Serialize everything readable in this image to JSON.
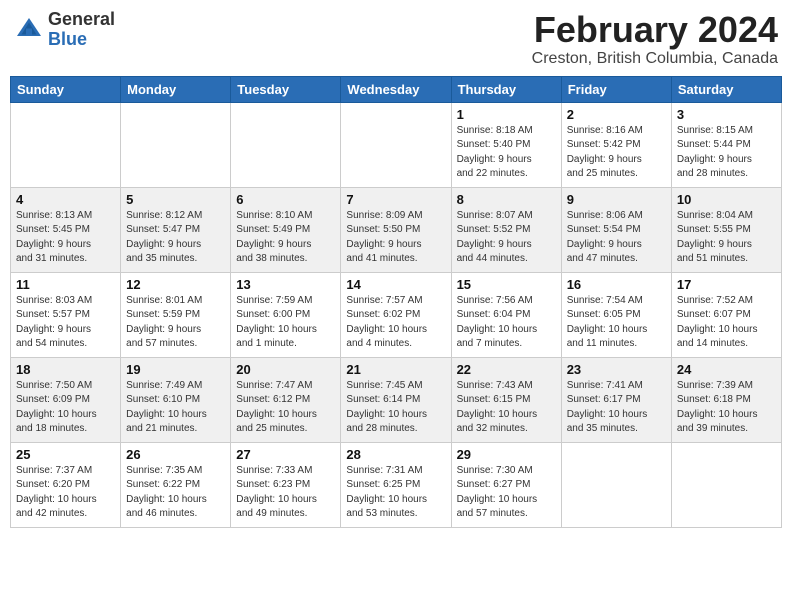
{
  "header": {
    "logo_general": "General",
    "logo_blue": "Blue",
    "month_title": "February 2024",
    "location": "Creston, British Columbia, Canada"
  },
  "days_of_week": [
    "Sunday",
    "Monday",
    "Tuesday",
    "Wednesday",
    "Thursday",
    "Friday",
    "Saturday"
  ],
  "weeks": [
    [
      {
        "day": "",
        "info": ""
      },
      {
        "day": "",
        "info": ""
      },
      {
        "day": "",
        "info": ""
      },
      {
        "day": "",
        "info": ""
      },
      {
        "day": "1",
        "info": "Sunrise: 8:18 AM\nSunset: 5:40 PM\nDaylight: 9 hours\nand 22 minutes."
      },
      {
        "day": "2",
        "info": "Sunrise: 8:16 AM\nSunset: 5:42 PM\nDaylight: 9 hours\nand 25 minutes."
      },
      {
        "day": "3",
        "info": "Sunrise: 8:15 AM\nSunset: 5:44 PM\nDaylight: 9 hours\nand 28 minutes."
      }
    ],
    [
      {
        "day": "4",
        "info": "Sunrise: 8:13 AM\nSunset: 5:45 PM\nDaylight: 9 hours\nand 31 minutes."
      },
      {
        "day": "5",
        "info": "Sunrise: 8:12 AM\nSunset: 5:47 PM\nDaylight: 9 hours\nand 35 minutes."
      },
      {
        "day": "6",
        "info": "Sunrise: 8:10 AM\nSunset: 5:49 PM\nDaylight: 9 hours\nand 38 minutes."
      },
      {
        "day": "7",
        "info": "Sunrise: 8:09 AM\nSunset: 5:50 PM\nDaylight: 9 hours\nand 41 minutes."
      },
      {
        "day": "8",
        "info": "Sunrise: 8:07 AM\nSunset: 5:52 PM\nDaylight: 9 hours\nand 44 minutes."
      },
      {
        "day": "9",
        "info": "Sunrise: 8:06 AM\nSunset: 5:54 PM\nDaylight: 9 hours\nand 47 minutes."
      },
      {
        "day": "10",
        "info": "Sunrise: 8:04 AM\nSunset: 5:55 PM\nDaylight: 9 hours\nand 51 minutes."
      }
    ],
    [
      {
        "day": "11",
        "info": "Sunrise: 8:03 AM\nSunset: 5:57 PM\nDaylight: 9 hours\nand 54 minutes."
      },
      {
        "day": "12",
        "info": "Sunrise: 8:01 AM\nSunset: 5:59 PM\nDaylight: 9 hours\nand 57 minutes."
      },
      {
        "day": "13",
        "info": "Sunrise: 7:59 AM\nSunset: 6:00 PM\nDaylight: 10 hours\nand 1 minute."
      },
      {
        "day": "14",
        "info": "Sunrise: 7:57 AM\nSunset: 6:02 PM\nDaylight: 10 hours\nand 4 minutes."
      },
      {
        "day": "15",
        "info": "Sunrise: 7:56 AM\nSunset: 6:04 PM\nDaylight: 10 hours\nand 7 minutes."
      },
      {
        "day": "16",
        "info": "Sunrise: 7:54 AM\nSunset: 6:05 PM\nDaylight: 10 hours\nand 11 minutes."
      },
      {
        "day": "17",
        "info": "Sunrise: 7:52 AM\nSunset: 6:07 PM\nDaylight: 10 hours\nand 14 minutes."
      }
    ],
    [
      {
        "day": "18",
        "info": "Sunrise: 7:50 AM\nSunset: 6:09 PM\nDaylight: 10 hours\nand 18 minutes."
      },
      {
        "day": "19",
        "info": "Sunrise: 7:49 AM\nSunset: 6:10 PM\nDaylight: 10 hours\nand 21 minutes."
      },
      {
        "day": "20",
        "info": "Sunrise: 7:47 AM\nSunset: 6:12 PM\nDaylight: 10 hours\nand 25 minutes."
      },
      {
        "day": "21",
        "info": "Sunrise: 7:45 AM\nSunset: 6:14 PM\nDaylight: 10 hours\nand 28 minutes."
      },
      {
        "day": "22",
        "info": "Sunrise: 7:43 AM\nSunset: 6:15 PM\nDaylight: 10 hours\nand 32 minutes."
      },
      {
        "day": "23",
        "info": "Sunrise: 7:41 AM\nSunset: 6:17 PM\nDaylight: 10 hours\nand 35 minutes."
      },
      {
        "day": "24",
        "info": "Sunrise: 7:39 AM\nSunset: 6:18 PM\nDaylight: 10 hours\nand 39 minutes."
      }
    ],
    [
      {
        "day": "25",
        "info": "Sunrise: 7:37 AM\nSunset: 6:20 PM\nDaylight: 10 hours\nand 42 minutes."
      },
      {
        "day": "26",
        "info": "Sunrise: 7:35 AM\nSunset: 6:22 PM\nDaylight: 10 hours\nand 46 minutes."
      },
      {
        "day": "27",
        "info": "Sunrise: 7:33 AM\nSunset: 6:23 PM\nDaylight: 10 hours\nand 49 minutes."
      },
      {
        "day": "28",
        "info": "Sunrise: 7:31 AM\nSunset: 6:25 PM\nDaylight: 10 hours\nand 53 minutes."
      },
      {
        "day": "29",
        "info": "Sunrise: 7:30 AM\nSunset: 6:27 PM\nDaylight: 10 hours\nand 57 minutes."
      },
      {
        "day": "",
        "info": ""
      },
      {
        "day": "",
        "info": ""
      }
    ]
  ]
}
